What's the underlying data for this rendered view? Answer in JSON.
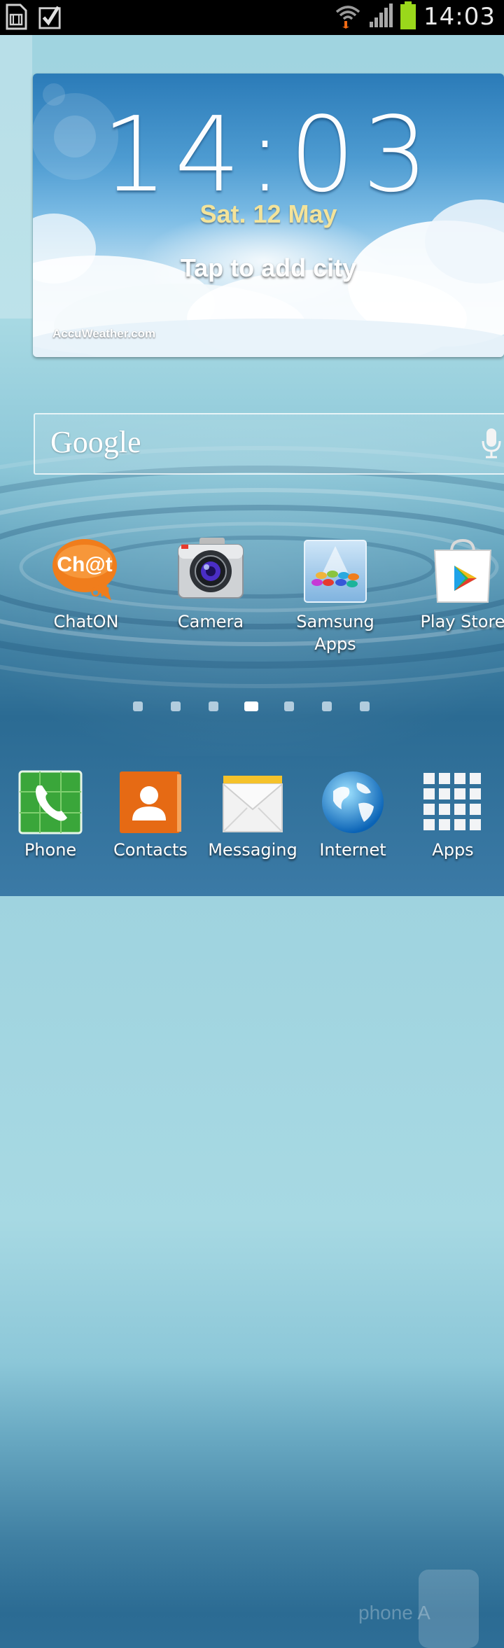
{
  "status_bar": {
    "time": "14:03",
    "icons": [
      "sim-card-icon",
      "checkbox-icon",
      "wifi-icon",
      "signal-icon",
      "battery-icon"
    ],
    "battery_color": "#9ad81b"
  },
  "weather_widget": {
    "time": "14:03",
    "date": "Sat. 12 May",
    "city_prompt": "Tap to add city",
    "brand": "AccuWeather.com"
  },
  "search_widget": {
    "logo": "Google",
    "mic_icon": "microphone-icon"
  },
  "home_apps": [
    {
      "label": "ChatON",
      "icon": "chaton-icon"
    },
    {
      "label": "Camera",
      "icon": "camera-icon"
    },
    {
      "label": "Samsung Apps",
      "icon": "samsung-apps-icon"
    },
    {
      "label": "Play Store",
      "icon": "play-store-icon"
    }
  ],
  "page_indicator": {
    "count": 7,
    "active_index": 3
  },
  "dock": [
    {
      "label": "Phone",
      "icon": "phone-icon"
    },
    {
      "label": "Contacts",
      "icon": "contacts-icon"
    },
    {
      "label": "Messaging",
      "icon": "messaging-icon"
    },
    {
      "label": "Internet",
      "icon": "internet-globe-icon"
    },
    {
      "label": "Apps",
      "icon": "apps-grid-icon"
    }
  ],
  "watermark": "phone A"
}
